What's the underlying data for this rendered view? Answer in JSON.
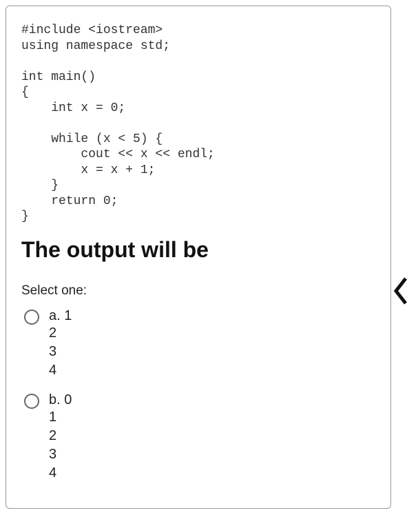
{
  "code": "#include <iostream>\nusing namespace std;\n\nint main()\n{\n    int x = 0;\n\n    while (x < 5) {\n        cout << x << endl;\n        x = x + 1;\n    }\n    return 0;\n}",
  "question_heading": "The output will be",
  "select_prompt": "Select one:",
  "options": [
    {
      "label": "a.",
      "text": "1\n2\n3\n4"
    },
    {
      "label": "b.",
      "text": "0\n1\n2\n3\n4"
    }
  ]
}
